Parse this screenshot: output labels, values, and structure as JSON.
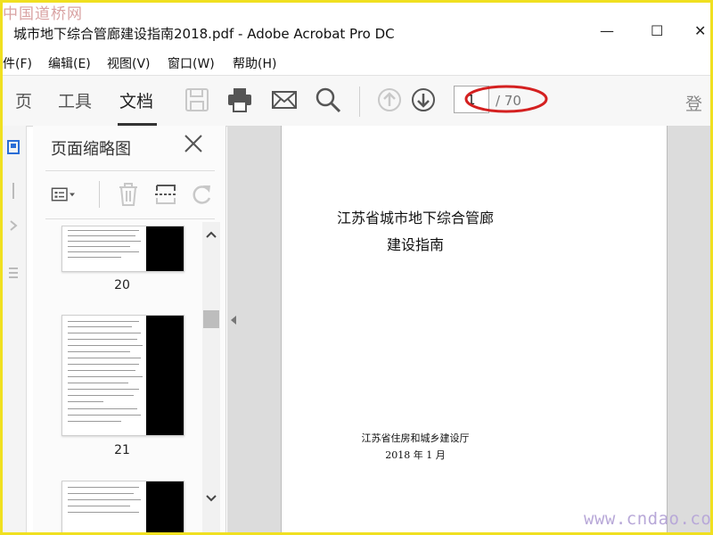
{
  "watermark": {
    "top": "中国道桥网",
    "bottom": "www.cndao.com"
  },
  "window": {
    "title": "城市地下综合管廊建设指南2018.pdf - Adobe Acrobat Pro DC",
    "controls": {
      "minimize": "—",
      "maximize": "☐",
      "close": "✕"
    }
  },
  "menu": {
    "items": [
      "件(F)",
      "编辑(E)",
      "视图(V)",
      "窗口(W)",
      "帮助(H)"
    ]
  },
  "toolbar": {
    "tabs": [
      "页",
      "工具",
      "文档"
    ],
    "active_tab": "文档",
    "icons": [
      "save-icon",
      "print-icon",
      "email-icon",
      "search-icon",
      "page-up-icon",
      "page-down-icon"
    ],
    "page_current": "1",
    "page_total": "/ 70",
    "login_label": "登",
    "highlight_color": "#d42020"
  },
  "thumbnail_panel": {
    "title": "页面缩略图",
    "tools": [
      "options-icon",
      "delete-icon",
      "crop-icon",
      "rotate-icon"
    ],
    "pages": [
      {
        "label": "20"
      },
      {
        "label": "21"
      },
      {
        "label": ""
      }
    ]
  },
  "document": {
    "title_line1": "江苏省城市地下综合管廊",
    "title_line2": "建设指南",
    "organization": "江苏省住房和城乡建设厅",
    "date": "2018 年 1 月"
  }
}
